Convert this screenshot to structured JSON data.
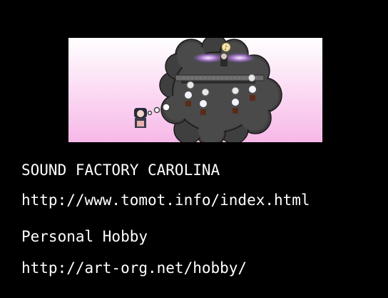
{
  "credits": {
    "lines": [
      "SOUND FACTORY CAROLINA",
      "http://www.tomot.info/index.html",
      "Personal Hobby",
      "http://art-org.net/hobby/"
    ]
  },
  "banner": {
    "background_top": "#ffffff",
    "background_bottom": "#f7b8e8",
    "cloud_color": "#3f3f3f",
    "glow_color": "#d89cff",
    "music_note_icon": "music-note-icon"
  }
}
